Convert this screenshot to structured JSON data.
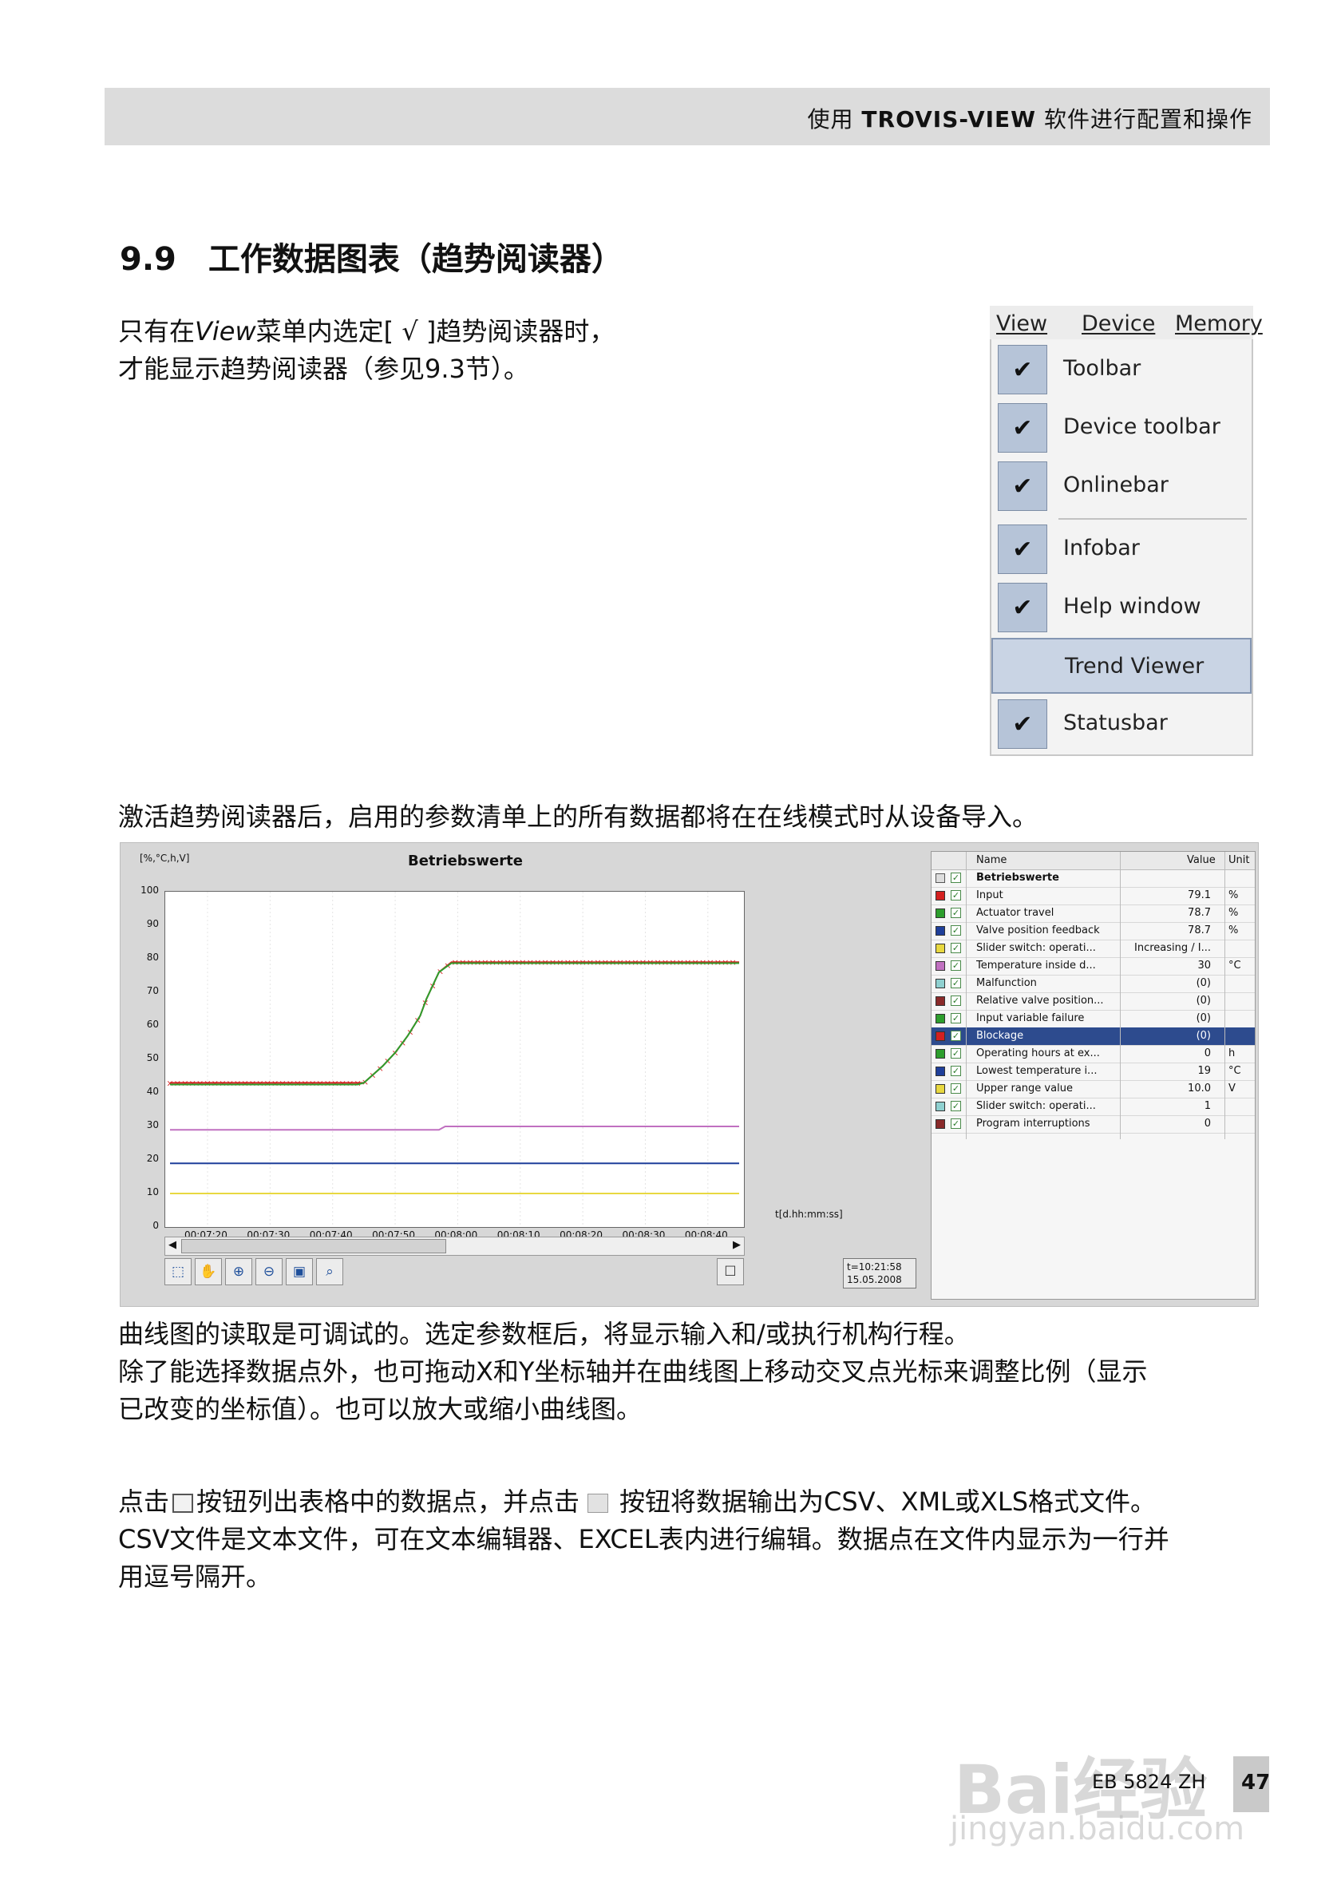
{
  "header": {
    "prefix": "使用",
    "brand": "TROVIS-VIEW",
    "suffix": "软件进行配置和操作"
  },
  "section": {
    "number": "9.9",
    "title": "工作数据图表（趋势阅读器）"
  },
  "intro": {
    "part1": "只有在",
    "view_word": "View",
    "part2": "菜单内选定[ √ ]趋势阅读器时，",
    "line2": "才能显示趋势阅读器（参见9.3节）。"
  },
  "menu": {
    "bar": [
      "View",
      "Device",
      "Memory"
    ],
    "items": [
      {
        "label": "Toolbar",
        "checked": true
      },
      {
        "label": "Device toolbar",
        "checked": true
      },
      {
        "label": "Onlinebar",
        "checked": true
      },
      {
        "label": "Infobar",
        "checked": true
      },
      {
        "label": "Help window",
        "checked": true
      },
      {
        "label": "Trend Viewer",
        "checked": false,
        "highlighted": true
      },
      {
        "label": "Statusbar",
        "checked": true
      }
    ],
    "check_glyph": "✔"
  },
  "para_activate": "激活趋势阅读器后，启用的参数清单上的所有数据都将在在线模式时从设备导入。",
  "screenshot": {
    "unit_label": "[%,°C,h,V]",
    "time_axis_label": "t[d.hh:mm:ss]",
    "timestamp": [
      "t=10:21:58",
      "15.05.2008"
    ],
    "table_header": {
      "name": "Name",
      "value": "Value",
      "unit": "Unit"
    },
    "group_label": "Betriebswerte",
    "rows": [
      {
        "color": "#d42020",
        "name": "Input",
        "value": "79.1",
        "unit": "%"
      },
      {
        "color": "#2d9e2d",
        "name": "Actuator travel",
        "value": "78.7",
        "unit": "%"
      },
      {
        "color": "#1f3f9a",
        "name": "Valve position feedback",
        "value": "78.7",
        "unit": "%"
      },
      {
        "color": "#e8d840",
        "name": "Slider switch: operati...",
        "value": "Increasing / I...",
        "unit": ""
      },
      {
        "color": "#c070c0",
        "name": "Temperature inside d...",
        "value": "30",
        "unit": "°C"
      },
      {
        "color": "#8fd0d0",
        "name": "Malfunction",
        "value": "(0)",
        "unit": ""
      },
      {
        "color": "#8a2a2a",
        "name": "Relative valve position...",
        "value": "(0)",
        "unit": ""
      },
      {
        "color": "#2d9e2d",
        "name": "Input variable failure",
        "value": "(0)",
        "unit": ""
      },
      {
        "color": "#d42020",
        "name": "Blockage",
        "value": "(0)",
        "unit": "",
        "selected": true
      },
      {
        "color": "#2d9e2d",
        "name": "Operating hours at ex...",
        "value": "0",
        "unit": "h"
      },
      {
        "color": "#1f3f9a",
        "name": "Lowest temperature i...",
        "value": "19",
        "unit": "°C"
      },
      {
        "color": "#e8d840",
        "name": "Upper range value",
        "value": "10.0",
        "unit": "V"
      },
      {
        "color": "#8fd0d0",
        "name": "Slider switch: operati...",
        "value": "1",
        "unit": ""
      },
      {
        "color": "#8a2a2a",
        "name": "Program interruptions",
        "value": "0",
        "unit": ""
      }
    ]
  },
  "chart_data": {
    "type": "line",
    "title": "Betriebswerte",
    "ylabel": "[%,°C,h,V]",
    "xlabel": "t[d.hh:mm:ss]",
    "ylim": [
      0,
      100
    ],
    "yticks": [
      "0",
      "10",
      "20",
      "30",
      "40",
      "50",
      "60",
      "70",
      "80",
      "90",
      "100"
    ],
    "xticks": [
      "00:07:20",
      "00:07:30",
      "00:07:40",
      "00:07:50",
      "00:08:00",
      "00:08:10",
      "00:08:20",
      "00:08:30",
      "00:08:40"
    ],
    "x_seconds_range": [
      0,
      91
    ],
    "grid": true,
    "series": [
      {
        "name": "Input",
        "color": "#d42020",
        "marker": "x",
        "x": [
          0,
          10,
          20,
          30,
          31,
          34,
          36,
          38,
          40,
          41,
          42,
          43,
          45,
          91
        ],
        "values": [
          43,
          43,
          43,
          43,
          43,
          48,
          52,
          57,
          63,
          68,
          72,
          76,
          79,
          79
        ]
      },
      {
        "name": "Actuator travel",
        "color": "#2d9e2d",
        "x": [
          0,
          30,
          31,
          34,
          36,
          38,
          40,
          41,
          42,
          43,
          45,
          91
        ],
        "values": [
          42.5,
          42.5,
          43,
          48,
          52,
          57,
          63,
          68,
          72,
          76,
          78.7,
          78.7
        ]
      },
      {
        "name": "Temperature inside d...",
        "color": "#c070c0",
        "x": [
          0,
          43,
          44,
          91
        ],
        "values": [
          29,
          29,
          30,
          30
        ]
      },
      {
        "name": "Lowest temperature i...",
        "color": "#1f3f9a",
        "x": [
          0,
          91
        ],
        "values": [
          19,
          19
        ]
      },
      {
        "name": "Upper range value",
        "color": "#e8d840",
        "x": [
          0,
          91
        ],
        "values": [
          10,
          10
        ]
      }
    ]
  },
  "para_curve": [
    "曲线图的读取是可调试的。选定参数框后，将显示输入和/或执行机构行程。",
    "除了能选择数据点外，也可拖动X和Y坐标轴并在曲线图上移动交叉点光标来调整比例（显示",
    "已改变的坐标值）。也可以放大或缩小曲线图。"
  ],
  "para_export": {
    "part1": "点击",
    "part2": "按钮列出表格中的数据点，并点击",
    "part3": "按钮将数据输出为CSV、XML或XLS格式文件。",
    "line2": "CSV文件是文本文件，可在文本编辑器、EXCEL表内进行编辑。数据点在文件内显示为一行并",
    "line3": "用逗号隔开。"
  },
  "footer": {
    "doc": "EB 5824 ZH",
    "page": "47"
  },
  "watermark": {
    "logo": "Bai经验",
    "url": "jingyan.baidu.com"
  }
}
